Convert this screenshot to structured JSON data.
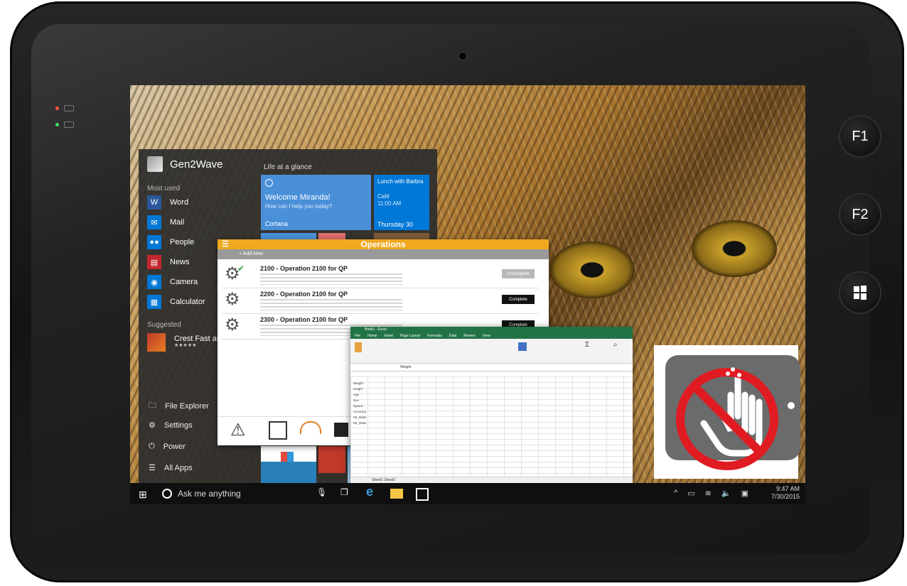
{
  "device": {
    "f1_label": "F1",
    "f2_label": "F2",
    "windows_key_label": "⊞"
  },
  "start_menu": {
    "user": "Gen2Wave",
    "most_used_heading": "Most used",
    "apps": [
      {
        "label": "Word",
        "icon": "word-icon",
        "color": "#2b579a",
        "glyph": "W"
      },
      {
        "label": "Mail",
        "icon": "mail-icon",
        "color": "#0078d7",
        "glyph": "✉"
      },
      {
        "label": "People",
        "icon": "people-icon",
        "color": "#0078d7",
        "glyph": "👥"
      },
      {
        "label": "News",
        "icon": "news-icon",
        "color": "#c1272d",
        "glyph": "▤"
      },
      {
        "label": "Camera",
        "icon": "camera-icon",
        "color": "#0078d7",
        "glyph": "◉"
      },
      {
        "label": "Calculator",
        "icon": "calculator-icon",
        "color": "#0078d7",
        "glyph": "▦"
      }
    ],
    "suggested_heading": "Suggested",
    "suggested_app": "Crest Fast as Lightn",
    "suggested_stars": "★★★★★",
    "bottom": {
      "file_explorer": "File Explorer",
      "settings": "Settings",
      "power": "Power",
      "all_apps": "All Apps"
    },
    "tiles": {
      "glance_heading": "Life at a glance",
      "cortana_title": "Welcome Miranda!",
      "cortana_sub": "How can I help you today?",
      "cortana_footer": "Cortana",
      "calendar_event": "Lunch with Barbra",
      "calendar_place": "Café",
      "calendar_time": "11:00 AM",
      "calendar_day": "Thursday 30"
    }
  },
  "operations_app": {
    "title": "Operations",
    "add_new": "Add New",
    "rows": [
      {
        "title": "2100 - Operation 2100 for QP",
        "button": "Uncomplete",
        "button_color": "#b8b8b8"
      },
      {
        "title": "2200 - Operation 2100 for QP",
        "button": "Complete",
        "button_color": "#111111"
      },
      {
        "title": "2300 - Operation 2100 for QP",
        "button": "Complete",
        "button_color": "#111111"
      }
    ]
  },
  "excel": {
    "title": "Book1 - Excel",
    "tabs": [
      "File",
      "Home",
      "Insert",
      "Page Layout",
      "Formulas",
      "Data",
      "Review",
      "View"
    ],
    "formula_value": "Weight",
    "cells": [
      "Weight",
      "Height",
      "Age",
      "Sex",
      "Speed",
      "Accuracy",
      "Hit_Ratio",
      "Hit_Ratio"
    ],
    "sheets": "Sheet1   Sheet2"
  },
  "taskbar": {
    "search_placeholder": "Ask me anything",
    "clock_time": "9:47 AM",
    "clock_date": "7/30/2015"
  },
  "colors": {
    "operations_accent": "#f0a820",
    "excel_green": "#217346",
    "no_touch_red": "#e11b22"
  }
}
